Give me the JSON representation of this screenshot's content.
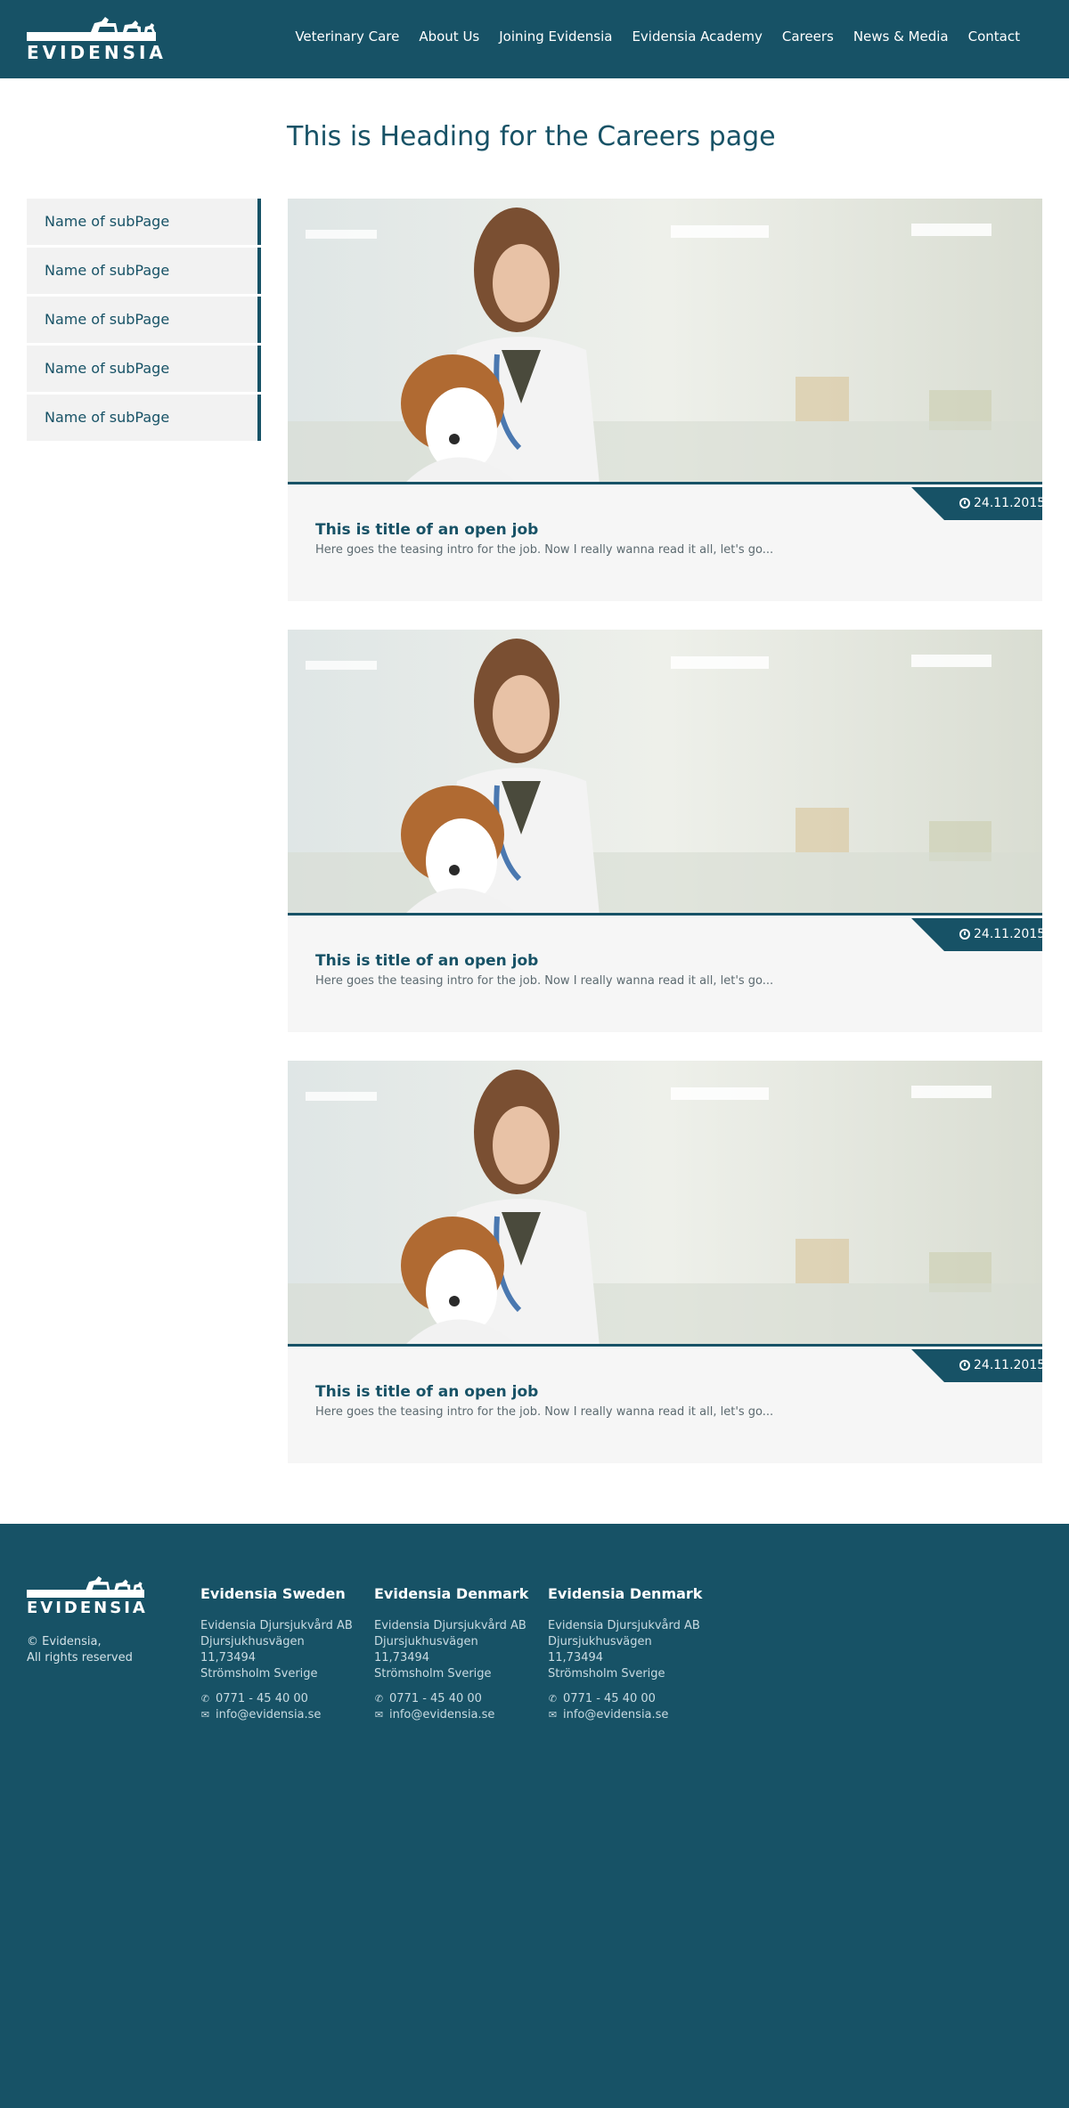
{
  "brand": {
    "logo_text": "EVIDENSIA"
  },
  "nav": {
    "items": [
      {
        "label": "Veterinary Care"
      },
      {
        "label": "About Us"
      },
      {
        "label": "Joining Evidensia"
      },
      {
        "label": "Evidensia Academy"
      },
      {
        "label": "Careers"
      },
      {
        "label": "News & Media"
      },
      {
        "label": "Contact"
      }
    ]
  },
  "page": {
    "title": "This is Heading for the Careers page"
  },
  "sidebar": {
    "items": [
      {
        "label": "Name of subPage"
      },
      {
        "label": "Name of subPage"
      },
      {
        "label": "Name of subPage"
      },
      {
        "label": "Name of subPage"
      },
      {
        "label": "Name of subPage"
      }
    ]
  },
  "jobs": [
    {
      "date": "24.11.2015",
      "title": "This is title of an open job",
      "intro": "Here goes the teasing intro for the job. Now I really wanna read it all, let's go..."
    },
    {
      "date": "24.11.2015",
      "title": "This is title of an open job",
      "intro": "Here goes the teasing intro for the job. Now I really wanna read it all, let's go..."
    },
    {
      "date": "24.11.2015",
      "title": "This is title of an open job",
      "intro": "Here goes the teasing intro for the job. Now I really wanna read it all, let's go..."
    }
  ],
  "footer": {
    "logo_text": "EVIDENSIA",
    "copyright_line1": "© Evidensia,",
    "copyright_line2": "All rights reserved",
    "columns": [
      {
        "heading": "Evidensia Sweden",
        "company": "Evidensia Djursjukvård AB",
        "street": "Djursjukhusvägen 11,73494",
        "city": "Strömsholm Sverige",
        "phone": "0771 - 45 40 00",
        "email": "info@evidensia.se"
      },
      {
        "heading": "Evidensia Denmark",
        "company": "Evidensia Djursjukvård AB",
        "street": "Djursjukhusvägen 11,73494",
        "city": "Strömsholm Sverige",
        "phone": "0771 - 45 40 00",
        "email": "info@evidensia.se"
      },
      {
        "heading": "Evidensia Denmark",
        "company": "Evidensia Djursjukvård AB",
        "street": "Djursjukhusvägen 11,73494",
        "city": "Strömsholm Sverige",
        "phone": "0771 - 45 40 00",
        "email": "info@evidensia.se"
      }
    ]
  },
  "colors": {
    "brand": "#175266",
    "panel": "#f6f6f6",
    "sidebar_bg": "#f2f2f2"
  }
}
